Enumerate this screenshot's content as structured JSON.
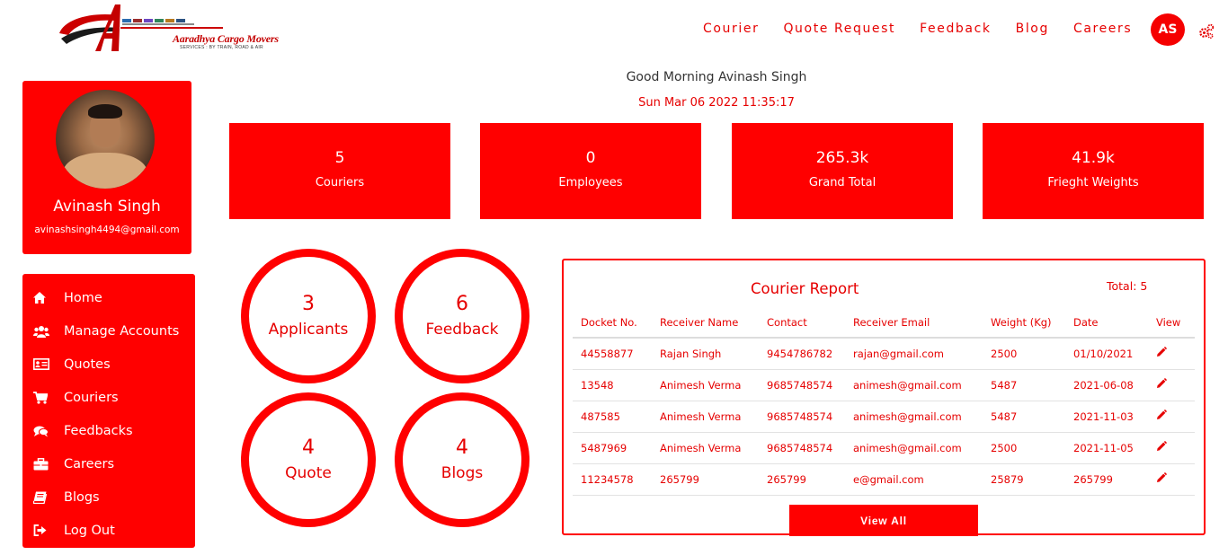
{
  "brand": {
    "logo_text": "Aaradhya Cargo Movers",
    "logo_tagline": "SERVICES : BY TRAIN, ROAD & AIR"
  },
  "topnav": {
    "items": [
      "Courier",
      "Quote Request",
      "Feedback",
      "Blog",
      "Careers"
    ],
    "avatar_initials": "AS",
    "settings_icon": "gears-icon"
  },
  "greeting": {
    "text": "Good Morning Avinash Singh",
    "datetime": "Sun Mar 06 2022 11:35:17"
  },
  "profile": {
    "name": "Avinash Singh",
    "email": "avinashsingh4494@gmail.com"
  },
  "sidebar": {
    "items": [
      {
        "label": "Home",
        "icon": "home-icon"
      },
      {
        "label": "Manage Accounts",
        "icon": "users-icon"
      },
      {
        "label": "Quotes",
        "icon": "id-card-icon"
      },
      {
        "label": "Couriers",
        "icon": "cart-icon"
      },
      {
        "label": "Feedbacks",
        "icon": "comments-icon"
      },
      {
        "label": "Careers",
        "icon": "briefcase-icon"
      },
      {
        "label": "Blogs",
        "icon": "book-icon"
      },
      {
        "label": "Log Out",
        "icon": "sign-out-icon"
      }
    ]
  },
  "stats": [
    {
      "value": "5",
      "label": "Couriers"
    },
    {
      "value": "0",
      "label": "Employees"
    },
    {
      "value": "265.3k",
      "label": "Grand Total"
    },
    {
      "value": "41.9k",
      "label": "Frieght Weights"
    }
  ],
  "circles": [
    {
      "value": "3",
      "label": "Applicants"
    },
    {
      "value": "6",
      "label": "Feedback"
    },
    {
      "value": "4",
      "label": "Quote"
    },
    {
      "value": "4",
      "label": "Blogs"
    }
  ],
  "report": {
    "title": "Courier Report",
    "total": "Total: 5",
    "columns": [
      "Docket No.",
      "Receiver Name",
      "Contact",
      "Receiver Email",
      "Weight (Kg)",
      "Date",
      "View"
    ],
    "rows": [
      [
        "44558877",
        "Rajan Singh",
        "9454786782",
        "rajan@gmail.com",
        "2500",
        "01/10/2021"
      ],
      [
        "13548",
        "Animesh Verma",
        "9685748574",
        "animesh@gmail.com",
        "5487",
        "2021-06-08"
      ],
      [
        "487585",
        "Animesh Verma",
        "9685748574",
        "animesh@gmail.com",
        "5487",
        "2021-11-03"
      ],
      [
        "5487969",
        "Animesh Verma",
        "9685748574",
        "animesh@gmail.com",
        "2500",
        "2021-11-05"
      ],
      [
        "11234578",
        "265799",
        "265799",
        "e@gmail.com",
        "25879",
        "265799"
      ]
    ],
    "view_all_label": "View All"
  },
  "colors": {
    "primary": "#ff0000",
    "text_red": "#e60000"
  }
}
